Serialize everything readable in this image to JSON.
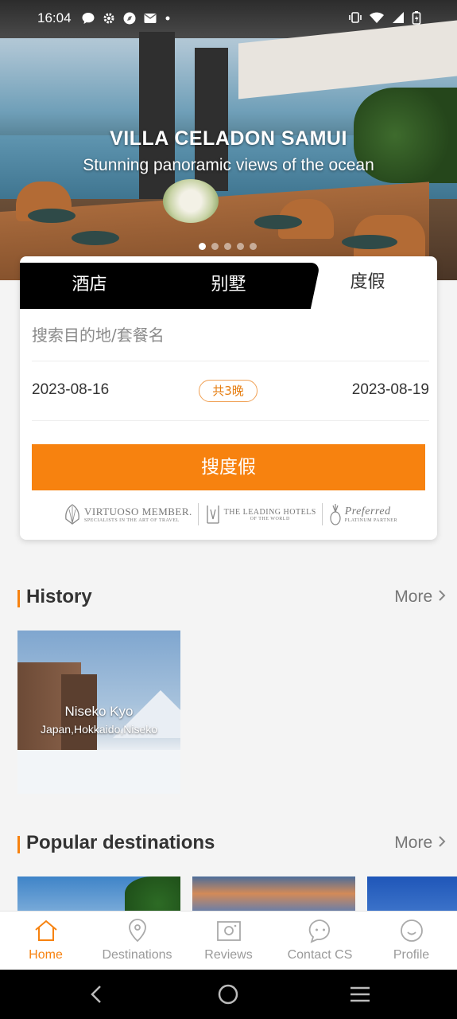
{
  "status_bar": {
    "time": "16:04",
    "left_icons": [
      "chat-icon",
      "gear-icon",
      "compass-icon",
      "mail-icon",
      "dot-icon"
    ],
    "right_icons": [
      "vibrate-icon",
      "wifi-icon",
      "signal-icon",
      "battery-icon"
    ]
  },
  "hero": {
    "title": "VILLA CELADON SAMUI",
    "subtitle": "Stunning panoramic views of the ocean",
    "carousel_total": 5,
    "carousel_active": 1
  },
  "search": {
    "tabs": [
      "酒店",
      "别墅",
      "度假"
    ],
    "active_tab": "度假",
    "placeholder": "搜索目的地/套餐名",
    "check_in": "2023-08-16",
    "check_out": "2023-08-19",
    "nights": "共3晚",
    "button": "搜度假",
    "partners": {
      "virtuoso": "VIRTUOSO MEMBER.",
      "virtuoso_tag": "SPECIALISTS IN THE ART OF TRAVEL",
      "lhw": "THE LEADING HOTELS",
      "lhw_tag": "OF THE WORLD",
      "preferred": "Preferred",
      "preferred_tag": "PLATINUM PARTNER"
    }
  },
  "history": {
    "title": "History",
    "more": "More",
    "items": [
      {
        "name": "Niseko Kyo",
        "location": "Japan,Hokkaido,Niseko"
      }
    ]
  },
  "popular": {
    "title": "Popular destinations",
    "more": "More"
  },
  "bottom_nav": {
    "items": [
      {
        "label": "Home",
        "icon": "home-icon",
        "active": true
      },
      {
        "label": "Destinations",
        "icon": "location-pin-icon",
        "active": false
      },
      {
        "label": "Reviews",
        "icon": "camera-icon",
        "active": false
      },
      {
        "label": "Contact CS",
        "icon": "chat-bubble-icon",
        "active": false
      },
      {
        "label": "Profile",
        "icon": "smiley-icon",
        "active": false
      }
    ]
  },
  "colors": {
    "accent": "#f7820f",
    "tab_black": "#000000",
    "text_gray": "#9a9a9a"
  }
}
